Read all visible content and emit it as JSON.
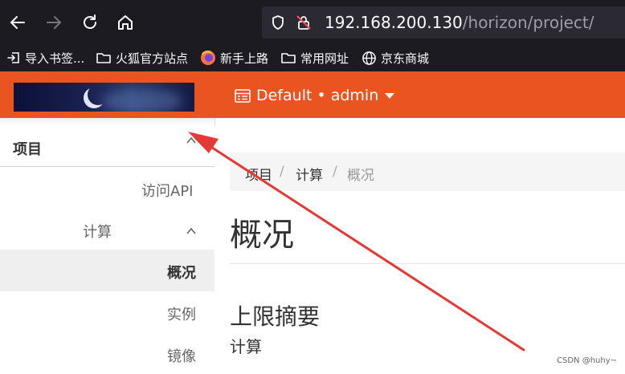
{
  "browser": {
    "url_host": "192.168.200.130",
    "url_path": "/horizon/project/"
  },
  "bookmarks": [
    {
      "label": "导入书签...",
      "icon": "import-icon"
    },
    {
      "label": "火狐官方站点",
      "icon": "folder-icon"
    },
    {
      "label": "新手上路",
      "icon": "firefox-icon"
    },
    {
      "label": "常用网址",
      "icon": "folder-icon"
    },
    {
      "label": "京东商城",
      "icon": "globe-icon"
    }
  ],
  "header": {
    "project_selector": "Default • admin",
    "accent_color": "#e95420"
  },
  "sidebar": {
    "section": "项目",
    "items": [
      {
        "label": "访问API"
      },
      {
        "label": "计算"
      },
      {
        "label": "概况"
      },
      {
        "label": "实例"
      },
      {
        "label": "镜像"
      }
    ]
  },
  "breadcrumb": [
    "项目",
    "计算",
    "概况"
  ],
  "main": {
    "title": "概况",
    "section_title": "上限摘要",
    "section_subtitle": "计算"
  },
  "annotation": {
    "arrow_color": "#e53935"
  },
  "watermark": "CSDN @huhy~"
}
